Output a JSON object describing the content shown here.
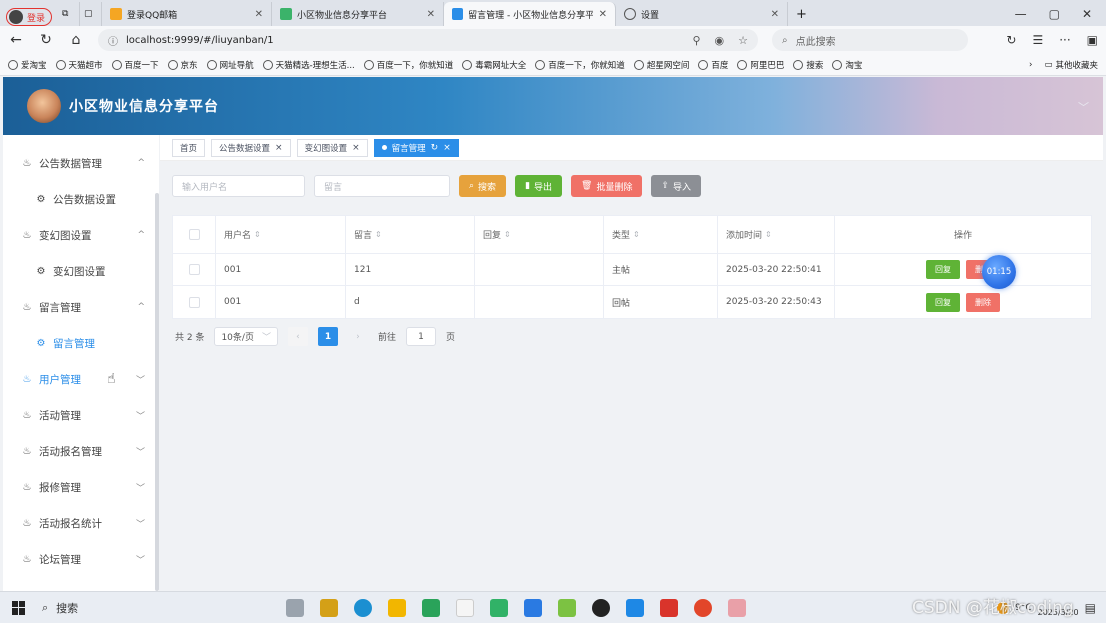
{
  "browser": {
    "login_label": "登录",
    "tabs": [
      {
        "title": "登录QQ邮箱",
        "active": false
      },
      {
        "title": "小区物业信息分享平台",
        "active": false
      },
      {
        "title": "留言管理 - 小区物业信息分享平台",
        "active": true
      },
      {
        "title": "设置",
        "active": false
      }
    ],
    "new_tab": "+",
    "url": "localhost:9999/#/liuyanban/1",
    "search_placeholder": "点此搜索",
    "bookmarks": [
      "爱淘宝",
      "天猫超市",
      "百度一下",
      "京东",
      "网址导航",
      "天猫精选-理想生活...",
      "百度一下，你就知道",
      "毒霸网址大全",
      "百度一下，你就知道",
      "超星网空间",
      "百度",
      "阿里巴巴",
      "搜索",
      "淘宝"
    ],
    "other_bookmarks": "其他收藏夹"
  },
  "app": {
    "title": "小区物业信息分享平台"
  },
  "sidebar": {
    "items": [
      {
        "label": "公告数据管理",
        "level": 1,
        "arrow": "^"
      },
      {
        "label": "公告数据设置",
        "level": 2
      },
      {
        "label": "变幻图设置",
        "level": 1,
        "arrow": "^"
      },
      {
        "label": "变幻图设置",
        "level": 2
      },
      {
        "label": "留言管理",
        "level": 1,
        "arrow": "^"
      },
      {
        "label": "留言管理",
        "level": 2,
        "active": true
      },
      {
        "label": "用户管理",
        "level": 1,
        "arrow": "v",
        "active": true
      },
      {
        "label": "活动管理",
        "level": 1,
        "arrow": "v"
      },
      {
        "label": "活动报名管理",
        "level": 1,
        "arrow": "v"
      },
      {
        "label": "报修管理",
        "level": 1,
        "arrow": "v"
      },
      {
        "label": "活动报名统计",
        "level": 1,
        "arrow": "v"
      },
      {
        "label": "论坛管理",
        "level": 1,
        "arrow": "v"
      }
    ]
  },
  "tags": [
    {
      "label": "首页",
      "closable": false,
      "active": false
    },
    {
      "label": "公告数据设置",
      "closable": true,
      "active": false
    },
    {
      "label": "变幻图设置",
      "closable": true,
      "active": false
    },
    {
      "label": "留言管理",
      "closable": true,
      "active": true
    }
  ],
  "filters": {
    "username_placeholder": "输入用户名",
    "message_placeholder": "留言",
    "search_label": "搜索",
    "export_label": "导出",
    "bulk_delete_label": "批量删除",
    "import_label": "导入"
  },
  "table": {
    "headers": [
      "用户名",
      "留言",
      "回复",
      "类型",
      "添加时间",
      "操作"
    ],
    "rows": [
      {
        "username": "001",
        "message": "121",
        "reply": "",
        "type": "主帖",
        "time": "2025-03-20 22:50:41"
      },
      {
        "username": "001",
        "message": "d",
        "reply": "",
        "type": "回帖",
        "time": "2025-03-20 22:50:43"
      }
    ],
    "reply_label": "回复",
    "delete_label": "删除"
  },
  "pagination": {
    "total": "共 2 条",
    "page_size": "10条/页",
    "current_page": "1",
    "goto_label": "前往",
    "goto_value": "1",
    "page_suffix": "页"
  },
  "timer_overlay": "01:15",
  "taskbar": {
    "search_label": "搜索",
    "weather": "9°C",
    "date": "2025/3/20"
  },
  "watermark": "CSDN @花椒coding",
  "colors": {
    "primary": "#2b8ee8",
    "search": "#e6a23c",
    "export": "#5fb336",
    "delete": "#f07167",
    "import": "#8c8f95"
  }
}
